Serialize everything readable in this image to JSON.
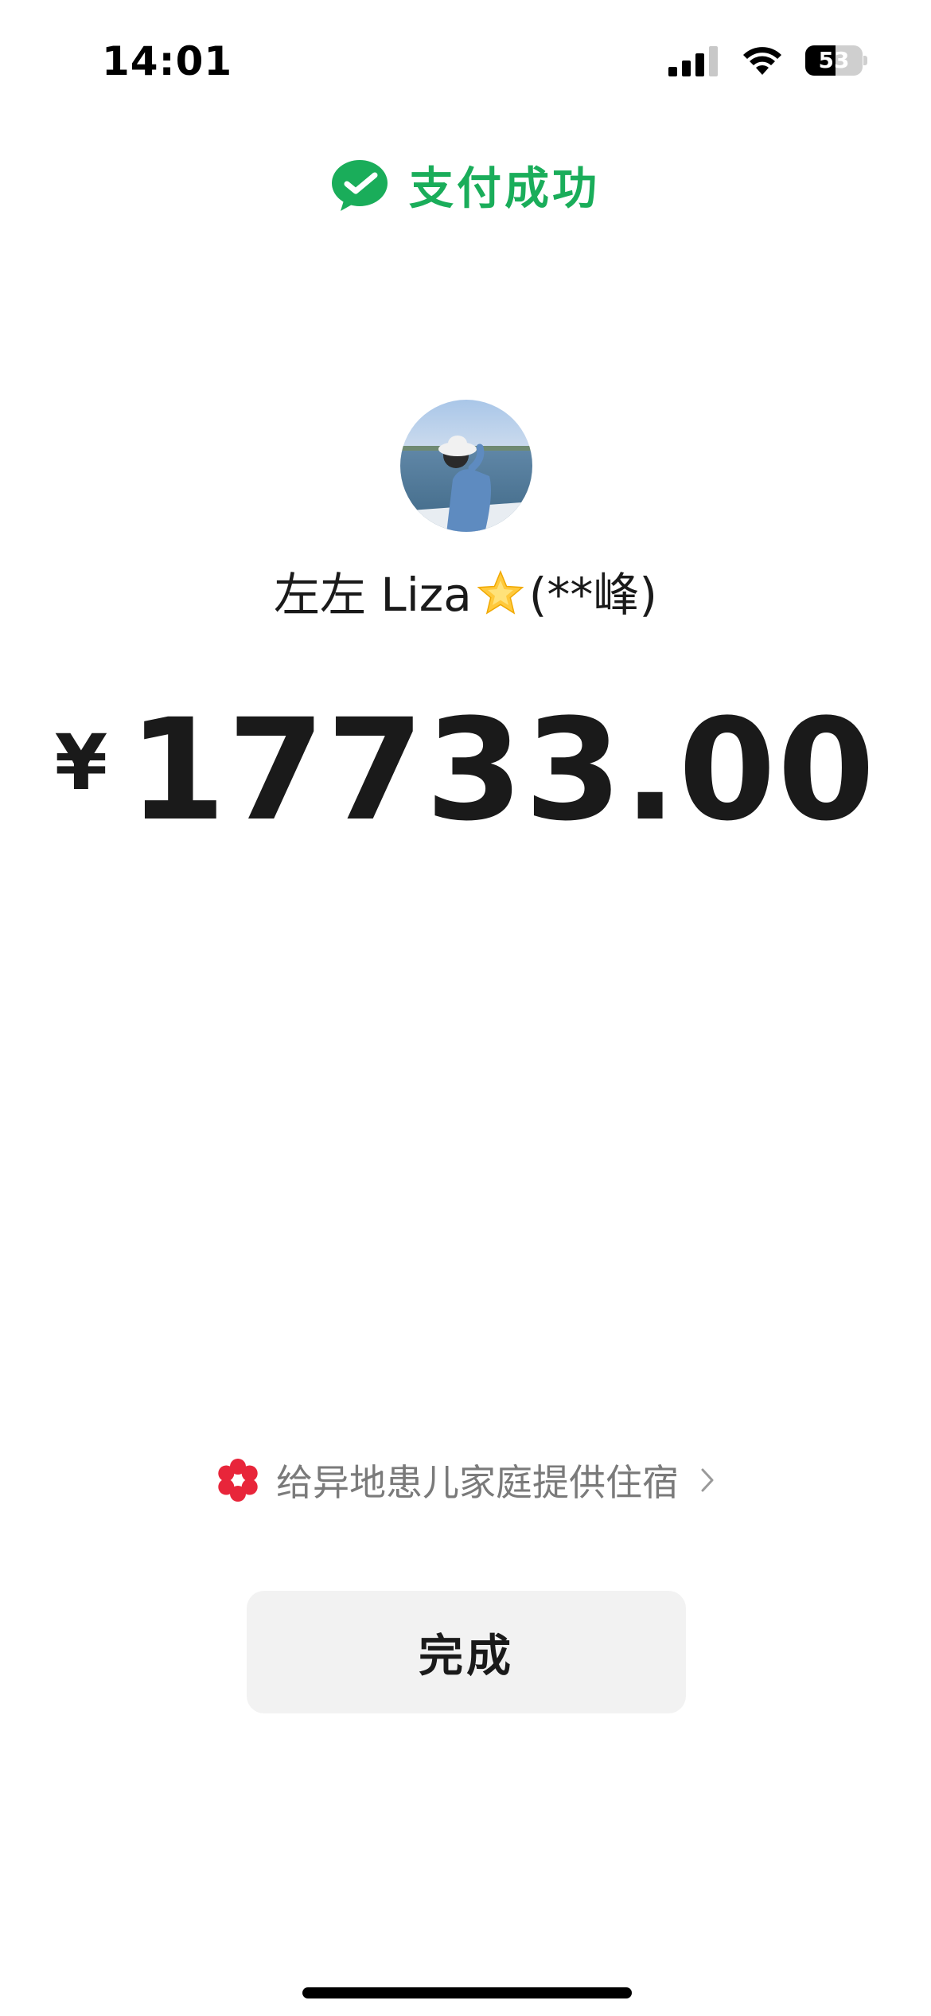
{
  "status_bar": {
    "time": "14:01",
    "battery_level": "53",
    "battery_fraction": 0.53,
    "signal_bars": 4,
    "signal_active": 3
  },
  "header": {
    "title": "支付成功",
    "icon": "wechat-pay-icon",
    "accent_color": "#1aad5a"
  },
  "payee": {
    "avatar_icon": "avatar-photo",
    "name_prefix": "左左 Liza",
    "name_emoji_icon": "star-icon",
    "name_suffix": "(**峰)"
  },
  "payment": {
    "currency_symbol": "¥",
    "amount": "17733.00"
  },
  "charity": {
    "icon": "flower-icon",
    "text": "给异地患儿家庭提供住宿",
    "icon_color": "#e8253a"
  },
  "actions": {
    "done_label": "完成"
  }
}
